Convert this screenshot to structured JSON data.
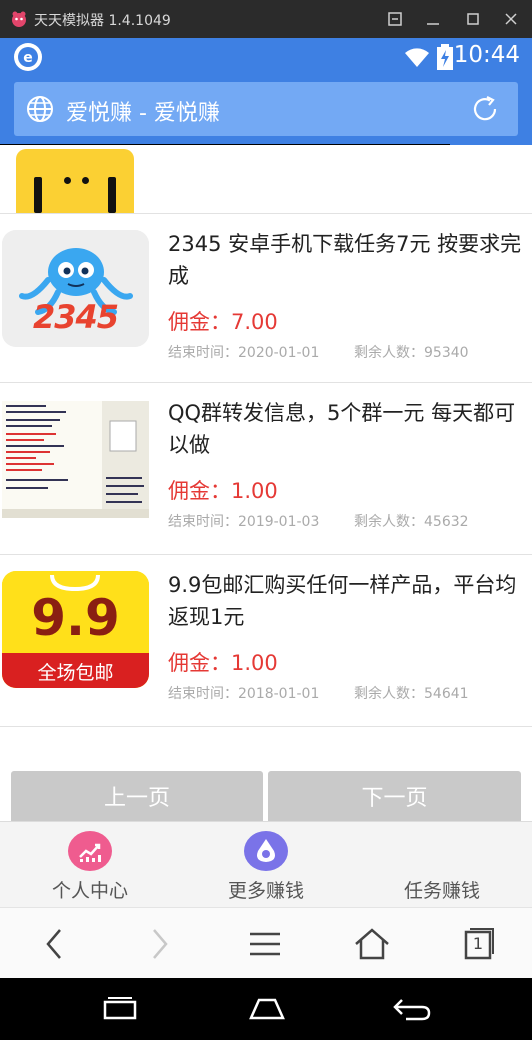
{
  "emulator": {
    "title": "天天模拟器 1.4.1049"
  },
  "status_bar": {
    "time": "10:44"
  },
  "browser": {
    "address_title": "爱悦赚 - 爱悦赚"
  },
  "tasks": [
    {
      "title": "2345 安卓手机下载任务7元 按要求完成",
      "price": "佣金：7.00",
      "end_time": "结束时间：2020-01-01",
      "remaining": "剩余人数：95340",
      "thumb_text": "2345"
    },
    {
      "title": "QQ群转发信息，5个群一元 每天都可以做",
      "price": "佣金：1.00",
      "end_time": "结束时间：2019-01-03",
      "remaining": "剩余人数：45632"
    },
    {
      "title": "9.9包邮汇购买任何一样产品，平台均返现1元",
      "price": "佣金：1.00",
      "end_time": "结束时间：2018-01-01",
      "remaining": "剩余人数：54641",
      "thumb_text": "9.9",
      "thumb_sub": "全场包邮"
    }
  ],
  "pager": {
    "prev": "上一页",
    "next": "下一页"
  },
  "tabbar": {
    "items": [
      {
        "label": "个人中心",
        "icon": "chart-icon",
        "color": "#ef5c8f"
      },
      {
        "label": "更多赚钱",
        "icon": "money-bag-icon",
        "color": "#7a73e8"
      },
      {
        "label": "任务赚钱",
        "icon": "none"
      }
    ]
  },
  "browser_nav": {
    "tab_count": "1"
  },
  "colors": {
    "brand_blue": "#3e80e3",
    "price_red": "#e53935"
  }
}
